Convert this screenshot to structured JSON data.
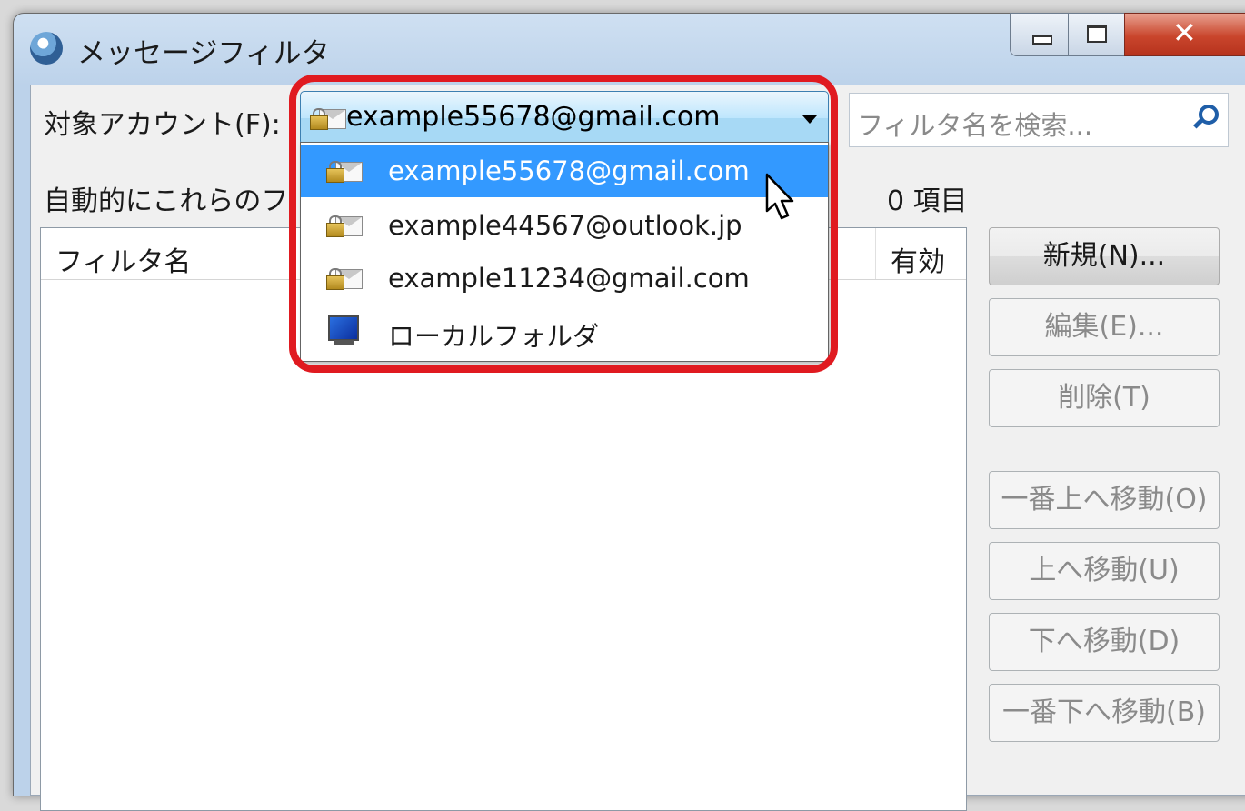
{
  "window": {
    "title": "メッセージフィルタ",
    "close_glyph": "✕"
  },
  "account": {
    "label": "対象アカウント(F):",
    "selected": "example55678@gmail.com",
    "options": [
      {
        "label": "example55678@gmail.com",
        "icon": "locked-mail-icon",
        "selected": true
      },
      {
        "label": "example44567@outlook.jp",
        "icon": "locked-mail-icon",
        "selected": false
      },
      {
        "label": "example11234@gmail.com",
        "icon": "locked-mail-icon",
        "selected": false
      },
      {
        "label": "ローカルフォルダ",
        "icon": "computer-icon",
        "selected": false
      }
    ]
  },
  "search": {
    "placeholder": "フィルタ名を検索..."
  },
  "filters": {
    "description": "自動的にこれらのフ",
    "count": "0 項目",
    "columns": {
      "name": "フィルタ名",
      "enabled": "有効"
    },
    "rows": []
  },
  "buttons": {
    "new": "新規(N)...",
    "edit": "編集(E)...",
    "delete": "削除(T)",
    "move_top": "一番上へ移動(O)",
    "move_up": "上へ移動(U)",
    "move_down": "下へ移動(D)",
    "move_bottom": "一番下へ移動(B)"
  },
  "colors": {
    "highlight": "#e01a20",
    "selection": "#3399ff"
  }
}
